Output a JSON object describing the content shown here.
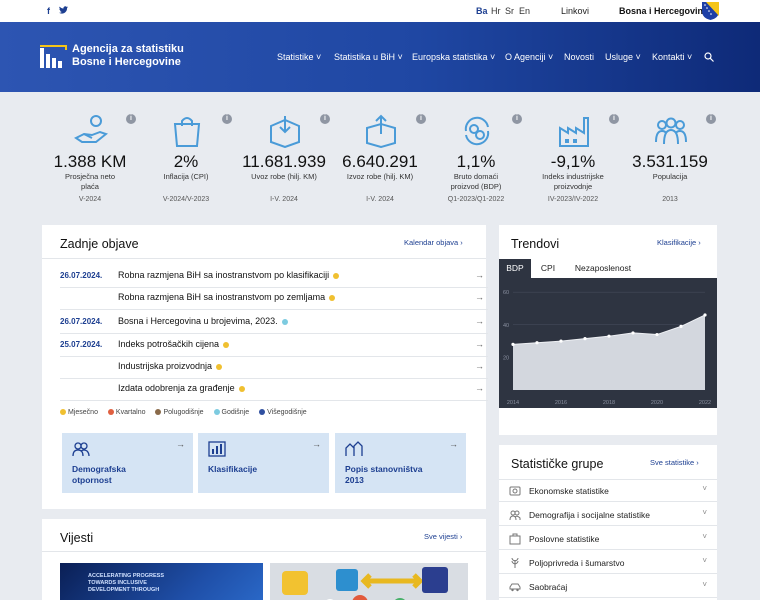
{
  "topbar": {
    "social": [
      "f",
      "twitter"
    ],
    "languages": [
      "Ba",
      "Hr",
      "Sr",
      "En"
    ],
    "links": "Linkovi",
    "country": "Bosna i Hercegovina"
  },
  "header": {
    "logo_line1": "Agencija za statistiku",
    "logo_line2": "Bosne i Hercegovine",
    "nav": [
      "Statistike",
      "Statistika u BiH",
      "Europska statistika",
      "O Agenciji",
      "Novosti",
      "Usluge",
      "Kontakti"
    ],
    "search_icon": "search-icon"
  },
  "stats": [
    {
      "icon": "hand-coins-icon",
      "value": "1.388 KM",
      "label1": "Prosječna neto",
      "label2": "plaća",
      "period": "V-2024"
    },
    {
      "icon": "shopping-bag-icon",
      "value": "2%",
      "label1": "Inflacija (CPI)",
      "label2": "",
      "period": "V-2024/V-2023"
    },
    {
      "icon": "box-import-icon",
      "value": "11.681.939",
      "label1": "Uvoz robe (hilj. KM)",
      "label2": "",
      "period": "I-V. 2024"
    },
    {
      "icon": "box-export-icon",
      "value": "6.640.291",
      "label1": "Izvoz robe (hilj. KM)",
      "label2": "",
      "period": "I-V. 2024"
    },
    {
      "icon": "coins-cycle-icon",
      "value": "1,1%",
      "label1": "Bruto domaći",
      "label2": "proizvod (BDP)",
      "period": "Q1-2023/Q1-2022"
    },
    {
      "icon": "factory-icon",
      "value": "-9,1%",
      "label1": "Indeks industrijske",
      "label2": "proizvodnje",
      "period": "IV-2023/IV-2022"
    },
    {
      "icon": "people-icon",
      "value": "3.531.159",
      "label1": "Populacija",
      "label2": "",
      "period": "2013"
    }
  ],
  "releases": {
    "title": "Zadnje objave",
    "link": "Kalendar objava",
    "items": [
      {
        "date": "26.07.2024.",
        "title": "Robna razmjena BiH sa inostranstvom po klasifikaciji",
        "dot": "#f0c030"
      },
      {
        "date": "",
        "title": "Robna razmjena BiH sa inostranstvom po zemljama",
        "dot": "#f0c030"
      },
      {
        "date": "26.07.2024.",
        "title": "Bosna i Hercegovina u brojevima, 2023.",
        "dot": "#7dcbe0"
      },
      {
        "date": "25.07.2024.",
        "title": "Indeks potrošačkih cijena",
        "dot": "#f0c030"
      },
      {
        "date": "",
        "title": "Industrijska proizvodnja",
        "dot": "#f0c030"
      },
      {
        "date": "",
        "title": "Izdata odobrenja za građenje",
        "dot": "#f0c030"
      }
    ],
    "legend": [
      {
        "label": "Mjesečno",
        "color": "#f0c030"
      },
      {
        "label": "Kvartalno",
        "color": "#e06040"
      },
      {
        "label": "Polugodišnje",
        "color": "#8a6a4a"
      },
      {
        "label": "Godišnje",
        "color": "#7dcbe0"
      },
      {
        "label": "Višegodišnje",
        "color": "#3050a0"
      }
    ]
  },
  "tiles": [
    {
      "icon": "people-icon",
      "label1": "Demografska",
      "label2": "otpornost"
    },
    {
      "icon": "chart-icon",
      "label1": "Klasifikacije",
      "label2": ""
    },
    {
      "icon": "census-icon",
      "label1": "Popis stanovništva",
      "label2": "2013"
    }
  ],
  "trends": {
    "title": "Trendovi",
    "link": "Klasifikacije",
    "tabs": [
      "BDP",
      "CPI",
      "Nezaposlenost"
    ],
    "active_tab": "BDP"
  },
  "chart_data": {
    "type": "area",
    "x": [
      2014,
      2015,
      2016,
      2017,
      2018,
      2019,
      2020,
      2021,
      2022
    ],
    "xticks": [
      "2014",
      "2016",
      "2018",
      "2020",
      "2022"
    ],
    "yticks": [
      "20",
      "40",
      "60"
    ],
    "values": [
      28,
      29,
      30,
      31.5,
      33,
      35,
      34,
      39,
      46
    ],
    "ylim": [
      0,
      65
    ],
    "title": "",
    "xlabel": "",
    "ylabel": ""
  },
  "groups": {
    "title": "Statističke grupe",
    "link": "Sve statistike",
    "items": [
      {
        "icon": "coins-icon",
        "label": "Ekonomske statistike"
      },
      {
        "icon": "people-icon",
        "label": "Demografija i socijalne statistike"
      },
      {
        "icon": "briefcase-icon",
        "label": "Poslovne statistike"
      },
      {
        "icon": "wheat-icon",
        "label": "Poljoprivreda i šumarstvo"
      },
      {
        "icon": "car-icon",
        "label": "Saobraćaj"
      }
    ]
  },
  "news": {
    "title": "Vijesti",
    "link": "Sve vijesti",
    "photo1_lines": [
      "ACCELERATING PROGRESS",
      "TOWARDS INCLUSIVE",
      "DEVELOPMENT THROUGH"
    ]
  },
  "colors": {
    "primary": "#1d3f91",
    "header": "#2349a8",
    "chart_bg": "#2e3441"
  }
}
